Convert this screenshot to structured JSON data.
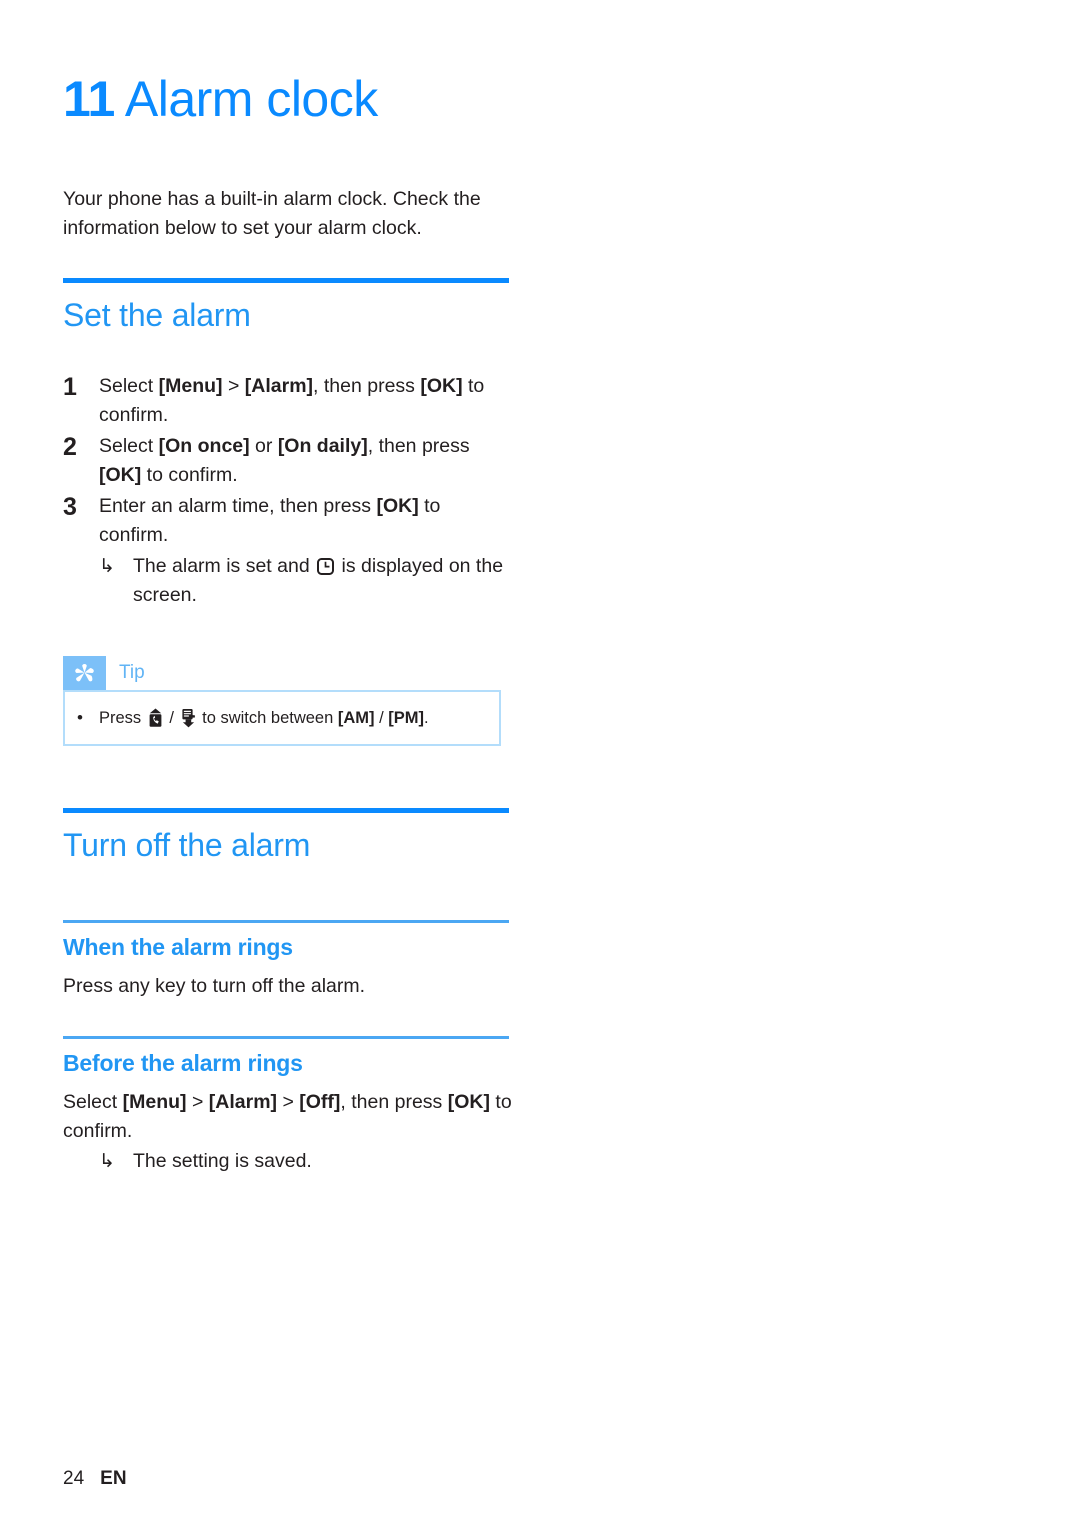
{
  "chapter": {
    "number": "11",
    "title": "Alarm clock"
  },
  "intro": "Your phone has a built-in alarm clock. Check the information below to set your alarm clock.",
  "sections": {
    "set_alarm": {
      "heading": "Set the alarm",
      "steps": [
        {
          "number": "1",
          "parts": [
            {
              "t": "Select ",
              "bold": false
            },
            {
              "t": "[Menu]",
              "bold": true
            },
            {
              "t": " > ",
              "bold": false
            },
            {
              "t": "[Alarm]",
              "bold": true
            },
            {
              "t": ", then press ",
              "bold": false
            },
            {
              "t": "[OK]",
              "bold": true
            },
            {
              "t": " to confirm.",
              "bold": false
            }
          ]
        },
        {
          "number": "2",
          "parts": [
            {
              "t": "Select ",
              "bold": false
            },
            {
              "t": "[On once]",
              "bold": true
            },
            {
              "t": " or ",
              "bold": false
            },
            {
              "t": "[On daily]",
              "bold": true
            },
            {
              "t": ", then press ",
              "bold": false
            },
            {
              "t": "[OK]",
              "bold": true
            },
            {
              "t": " to confirm.",
              "bold": false
            }
          ]
        },
        {
          "number": "3",
          "parts": [
            {
              "t": "Enter an alarm time, then press ",
              "bold": false
            },
            {
              "t": "[OK]",
              "bold": true
            },
            {
              "t": " to confirm.",
              "bold": false
            }
          ],
          "result": {
            "arrow": "↳",
            "before_icon": "The alarm is set and ",
            "icon": "clock-icon",
            "after_icon": " is displayed on the screen."
          }
        }
      ],
      "tip": {
        "badge_icon": "asterisk-icon",
        "label": "Tip",
        "bullet": "•",
        "before_icon1": "Press ",
        "icon1": "up-call-key-icon",
        "separator": " / ",
        "icon2": "down-menu-key-icon",
        "after_icons": " to switch between ",
        "am_label": "[AM]",
        "slash": " / ",
        "pm_label": "[PM]",
        "period": "."
      }
    },
    "turn_off_alarm": {
      "heading": "Turn off the alarm",
      "when_rings": {
        "heading": "When the alarm rings",
        "text": "Press any key to turn off the alarm."
      },
      "before_rings": {
        "heading": "Before the alarm rings",
        "parts": [
          {
            "t": "Select ",
            "bold": false
          },
          {
            "t": "[Menu]",
            "bold": true
          },
          {
            "t": " > ",
            "bold": false
          },
          {
            "t": "[Alarm]",
            "bold": true
          },
          {
            "t": " > ",
            "bold": false
          },
          {
            "t": "[Off]",
            "bold": true
          },
          {
            "t": ", then press ",
            "bold": false
          },
          {
            "t": "[OK]",
            "bold": true
          },
          {
            "t": " to confirm.",
            "bold": false
          }
        ],
        "result": {
          "arrow": "↳",
          "text": "The setting is saved."
        }
      }
    }
  },
  "footer": {
    "page_number": "24",
    "language": "EN"
  },
  "colors": {
    "heading_blue": "#2196f3",
    "title_blue": "#0a8aff",
    "rule_major": "#0a8aff",
    "rule_minor": "#4ba7f3",
    "tip_badge": "#7cc0f8",
    "tip_border": "#b3ddfb",
    "text": "#231f20"
  }
}
